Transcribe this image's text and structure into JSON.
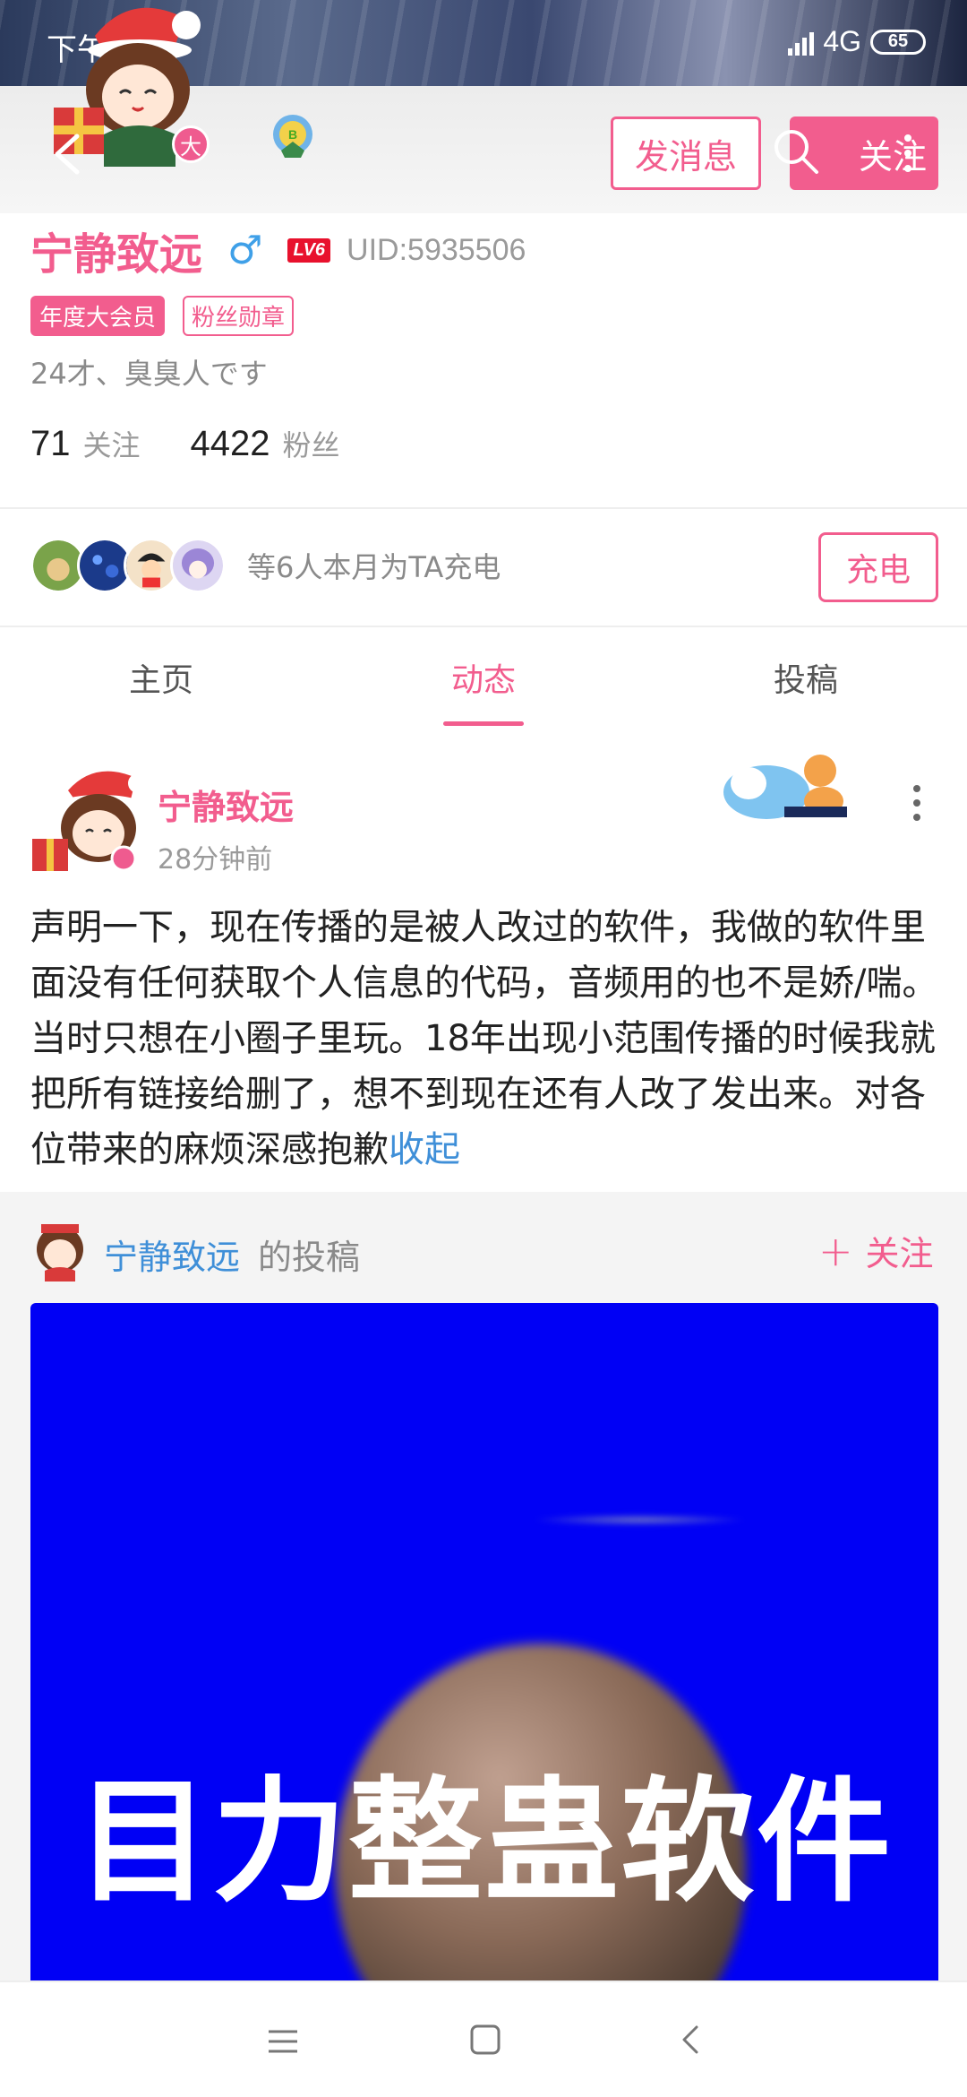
{
  "status_bar": {
    "time": "下午1:43",
    "network": "4G",
    "battery": "65"
  },
  "header": {
    "message_button": "发消息",
    "follow_button": "关注",
    "vip_badge": "大"
  },
  "profile": {
    "name": "宁静致远",
    "gender": "♂",
    "level": "LV6",
    "uid": "UID:5935506",
    "tags": [
      "年度大会员",
      "粉丝勋章"
    ],
    "bio": "24才、臭臭人です",
    "following_count": "71",
    "following_label": "关注",
    "fans_count": "4422",
    "fans_label": "粉丝"
  },
  "charge": {
    "text": "等6人本月为TA充电",
    "button": "充电"
  },
  "tabs": [
    {
      "label": "主页",
      "active": false
    },
    {
      "label": "动态",
      "active": true
    },
    {
      "label": "投稿",
      "active": false
    }
  ],
  "post": {
    "author": "宁静致远",
    "time": "28分钟前",
    "text": "声明一下，现在传播的是被人改过的软件，我做的软件里面没有任何获取个人信息的代码，音频用的也不是娇/喘。当时只想在小圈子里玩。18年出现小范围传播的时候我就把所有链接给删了，想不到现在还有人改了发出来。对各位带来的麻烦深感抱歉",
    "collapse_label": "收起"
  },
  "repost": {
    "author": "宁静致远",
    "suffix": "的投稿",
    "follow_label": "关注",
    "thumbnail_caption": "目力整蛊软件"
  },
  "colors": {
    "accent": "#f25d8e",
    "link": "#3f8fd8",
    "thumbnail_bg": "#0000f5"
  }
}
